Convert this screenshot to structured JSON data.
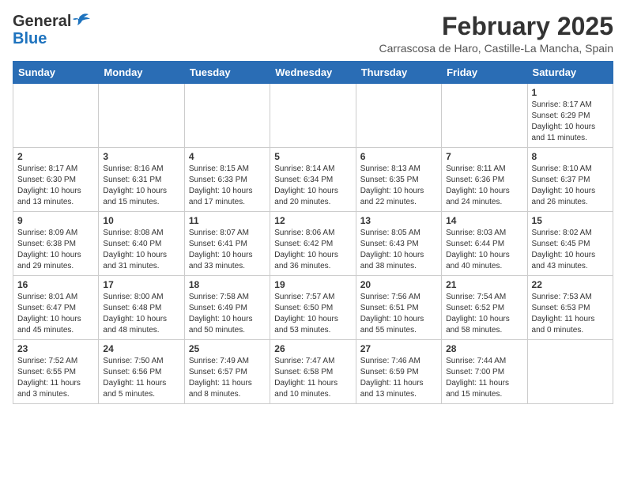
{
  "logo": {
    "general": "General",
    "blue": "Blue"
  },
  "title": "February 2025",
  "location": "Carrascosa de Haro, Castille-La Mancha, Spain",
  "days_of_week": [
    "Sunday",
    "Monday",
    "Tuesday",
    "Wednesday",
    "Thursday",
    "Friday",
    "Saturday"
  ],
  "weeks": [
    [
      {
        "day": "",
        "info": ""
      },
      {
        "day": "",
        "info": ""
      },
      {
        "day": "",
        "info": ""
      },
      {
        "day": "",
        "info": ""
      },
      {
        "day": "",
        "info": ""
      },
      {
        "day": "",
        "info": ""
      },
      {
        "day": "1",
        "info": "Sunrise: 8:17 AM\nSunset: 6:29 PM\nDaylight: 10 hours and 11 minutes."
      }
    ],
    [
      {
        "day": "2",
        "info": "Sunrise: 8:17 AM\nSunset: 6:30 PM\nDaylight: 10 hours and 13 minutes."
      },
      {
        "day": "3",
        "info": "Sunrise: 8:16 AM\nSunset: 6:31 PM\nDaylight: 10 hours and 15 minutes."
      },
      {
        "day": "4",
        "info": "Sunrise: 8:15 AM\nSunset: 6:33 PM\nDaylight: 10 hours and 17 minutes."
      },
      {
        "day": "5",
        "info": "Sunrise: 8:14 AM\nSunset: 6:34 PM\nDaylight: 10 hours and 20 minutes."
      },
      {
        "day": "6",
        "info": "Sunrise: 8:13 AM\nSunset: 6:35 PM\nDaylight: 10 hours and 22 minutes."
      },
      {
        "day": "7",
        "info": "Sunrise: 8:11 AM\nSunset: 6:36 PM\nDaylight: 10 hours and 24 minutes."
      },
      {
        "day": "8",
        "info": "Sunrise: 8:10 AM\nSunset: 6:37 PM\nDaylight: 10 hours and 26 minutes."
      }
    ],
    [
      {
        "day": "9",
        "info": "Sunrise: 8:09 AM\nSunset: 6:38 PM\nDaylight: 10 hours and 29 minutes."
      },
      {
        "day": "10",
        "info": "Sunrise: 8:08 AM\nSunset: 6:40 PM\nDaylight: 10 hours and 31 minutes."
      },
      {
        "day": "11",
        "info": "Sunrise: 8:07 AM\nSunset: 6:41 PM\nDaylight: 10 hours and 33 minutes."
      },
      {
        "day": "12",
        "info": "Sunrise: 8:06 AM\nSunset: 6:42 PM\nDaylight: 10 hours and 36 minutes."
      },
      {
        "day": "13",
        "info": "Sunrise: 8:05 AM\nSunset: 6:43 PM\nDaylight: 10 hours and 38 minutes."
      },
      {
        "day": "14",
        "info": "Sunrise: 8:03 AM\nSunset: 6:44 PM\nDaylight: 10 hours and 40 minutes."
      },
      {
        "day": "15",
        "info": "Sunrise: 8:02 AM\nSunset: 6:45 PM\nDaylight: 10 hours and 43 minutes."
      }
    ],
    [
      {
        "day": "16",
        "info": "Sunrise: 8:01 AM\nSunset: 6:47 PM\nDaylight: 10 hours and 45 minutes."
      },
      {
        "day": "17",
        "info": "Sunrise: 8:00 AM\nSunset: 6:48 PM\nDaylight: 10 hours and 48 minutes."
      },
      {
        "day": "18",
        "info": "Sunrise: 7:58 AM\nSunset: 6:49 PM\nDaylight: 10 hours and 50 minutes."
      },
      {
        "day": "19",
        "info": "Sunrise: 7:57 AM\nSunset: 6:50 PM\nDaylight: 10 hours and 53 minutes."
      },
      {
        "day": "20",
        "info": "Sunrise: 7:56 AM\nSunset: 6:51 PM\nDaylight: 10 hours and 55 minutes."
      },
      {
        "day": "21",
        "info": "Sunrise: 7:54 AM\nSunset: 6:52 PM\nDaylight: 10 hours and 58 minutes."
      },
      {
        "day": "22",
        "info": "Sunrise: 7:53 AM\nSunset: 6:53 PM\nDaylight: 11 hours and 0 minutes."
      }
    ],
    [
      {
        "day": "23",
        "info": "Sunrise: 7:52 AM\nSunset: 6:55 PM\nDaylight: 11 hours and 3 minutes."
      },
      {
        "day": "24",
        "info": "Sunrise: 7:50 AM\nSunset: 6:56 PM\nDaylight: 11 hours and 5 minutes."
      },
      {
        "day": "25",
        "info": "Sunrise: 7:49 AM\nSunset: 6:57 PM\nDaylight: 11 hours and 8 minutes."
      },
      {
        "day": "26",
        "info": "Sunrise: 7:47 AM\nSunset: 6:58 PM\nDaylight: 11 hours and 10 minutes."
      },
      {
        "day": "27",
        "info": "Sunrise: 7:46 AM\nSunset: 6:59 PM\nDaylight: 11 hours and 13 minutes."
      },
      {
        "day": "28",
        "info": "Sunrise: 7:44 AM\nSunset: 7:00 PM\nDaylight: 11 hours and 15 minutes."
      },
      {
        "day": "",
        "info": ""
      }
    ]
  ]
}
